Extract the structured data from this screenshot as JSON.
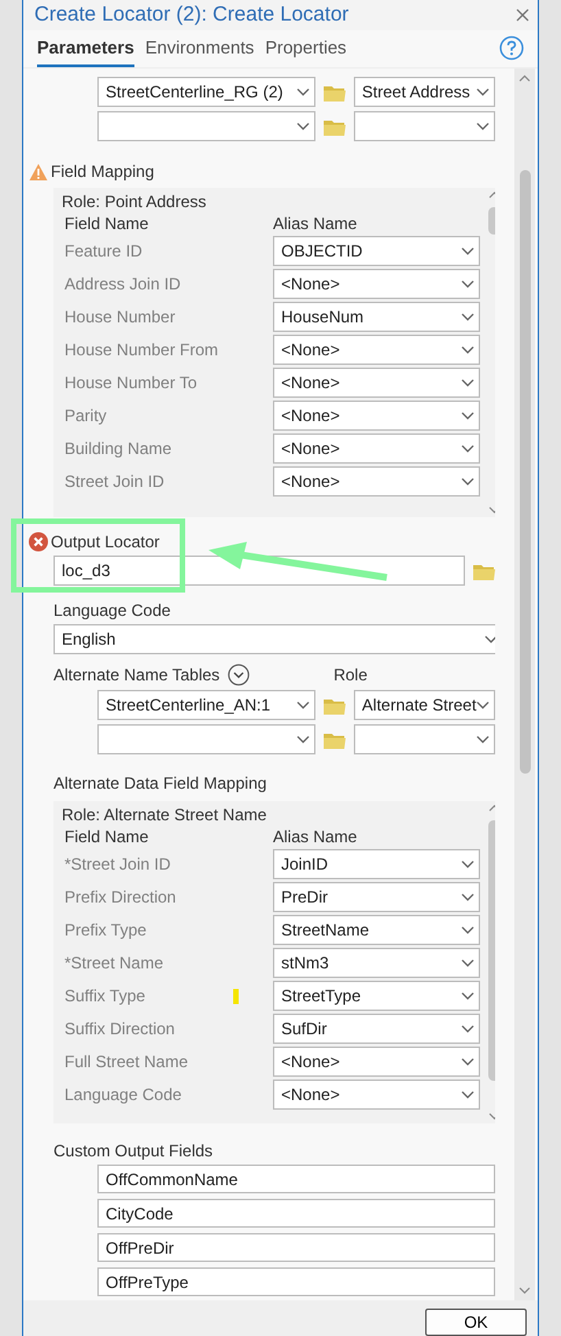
{
  "dialog": {
    "title": "Create Locator (2): Create Locator"
  },
  "tabs": [
    {
      "label": "Parameters",
      "selected": true
    },
    {
      "label": "Environments",
      "selected": false
    },
    {
      "label": "Properties",
      "selected": false
    }
  ],
  "reference_data": [
    {
      "kind": "filled",
      "table": "StreetCenterline_RG (2)",
      "role": "Street Address"
    },
    {
      "kind": "blank"
    }
  ],
  "field_mapping": {
    "label": "Field Mapping",
    "kind": "warning",
    "role": "Role: Point Address",
    "columns": [
      "Field Name",
      "Alias Name"
    ],
    "rows": [
      {
        "field": "Feature ID",
        "alias": "OBJECTID"
      },
      {
        "field": "Address Join ID",
        "alias": "<None>"
      },
      {
        "field": "House Number",
        "alias": "HouseNum"
      },
      {
        "field": "House Number From",
        "alias": "<None>"
      },
      {
        "field": "House Number To",
        "alias": "<None>"
      },
      {
        "field": "Parity",
        "alias": "<None>"
      },
      {
        "field": "Building Name",
        "alias": "<None>"
      },
      {
        "field": "Street Join ID",
        "alias": "<None>"
      }
    ]
  },
  "output_locator": {
    "label": "Output Locator",
    "kind": "error",
    "value": "loc_d3"
  },
  "language_code": {
    "label": "Language Code",
    "value": "English"
  },
  "alternate_name_tables": {
    "label": "Alternate Name Tables",
    "role_label": "Role",
    "rows": [
      {
        "kind": "filled",
        "table": "StreetCenterline_AN:1",
        "role": "Alternate Street"
      },
      {
        "kind": "blank"
      }
    ]
  },
  "alternate_data_field_mapping": {
    "label": "Alternate Data Field Mapping",
    "role": "Role: Alternate Street Name",
    "columns": [
      "Field Name",
      "Alias Name"
    ],
    "rows": [
      {
        "field": "*Street Join ID",
        "alias": "JoinID"
      },
      {
        "field": "Prefix Direction",
        "alias": "PreDir"
      },
      {
        "field": "Prefix Type",
        "alias": "StreetName"
      },
      {
        "field": "*Street Name",
        "alias": "stNm3"
      },
      {
        "field": "Suffix Type",
        "alias": "StreetType"
      },
      {
        "field": "Suffix Direction",
        "alias": "SufDir"
      },
      {
        "field": "Full Street Name",
        "alias": "<None>"
      },
      {
        "field": "Language Code",
        "alias": "<None>"
      }
    ]
  },
  "custom_output_fields": {
    "label": "Custom Output Fields",
    "values": [
      "OffCommonName",
      "CityCode",
      "OffPreDir",
      "OffPreType"
    ]
  },
  "buttons": [
    "OK"
  ]
}
